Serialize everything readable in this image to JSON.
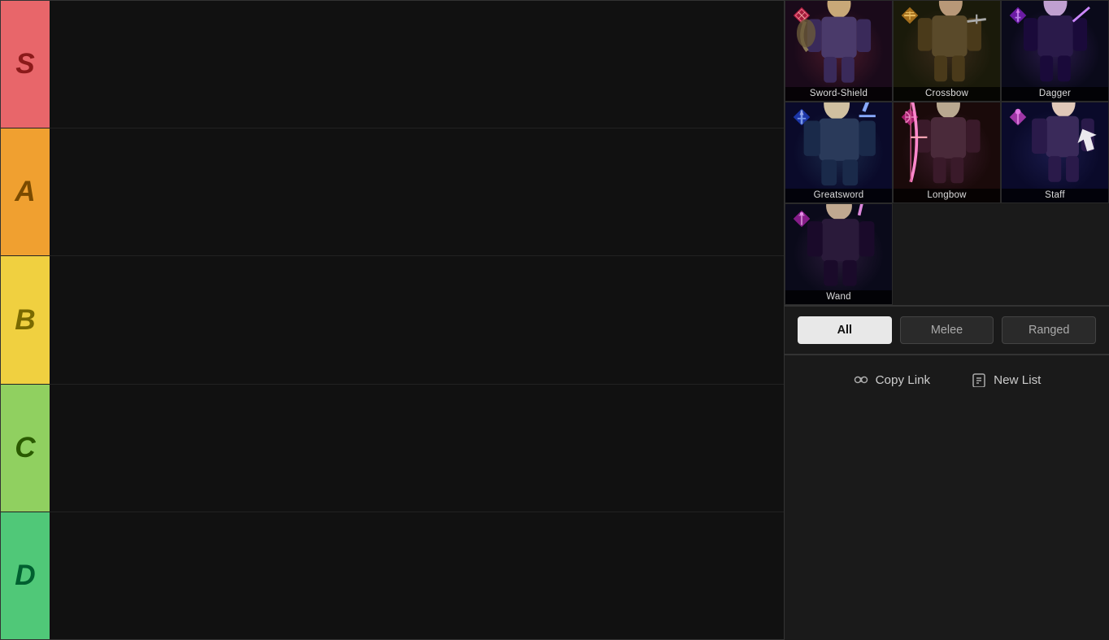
{
  "tiers": [
    {
      "id": "s",
      "label": "S",
      "color_bg": "#e8666a",
      "color_text": "#8b1a1a"
    },
    {
      "id": "a",
      "label": "A",
      "color_bg": "#f0a030",
      "color_text": "#7a4a00"
    },
    {
      "id": "b",
      "label": "B",
      "color_bg": "#f0d040",
      "color_text": "#7a6a00"
    },
    {
      "id": "c",
      "label": "C",
      "color_bg": "#90d060",
      "color_text": "#2a5a00"
    },
    {
      "id": "d",
      "label": "D",
      "color_bg": "#50c878",
      "color_text": "#006030"
    }
  ],
  "weapons": [
    {
      "id": "sword-shield",
      "name": "Sword-Shield",
      "class": "weapon-sword-shield",
      "accent": "#cc2244"
    },
    {
      "id": "crossbow",
      "name": "Crossbow",
      "class": "weapon-crossbow",
      "accent": "#cc8822"
    },
    {
      "id": "dagger",
      "name": "Dagger",
      "class": "weapon-dagger",
      "accent": "#8822cc"
    },
    {
      "id": "greatsword",
      "name": "Greatsword",
      "class": "weapon-greatsword",
      "accent": "#2244cc"
    },
    {
      "id": "longbow",
      "name": "Longbow",
      "class": "weapon-longbow",
      "accent": "#cc2288"
    },
    {
      "id": "staff",
      "name": "Staff",
      "class": "weapon-staff",
      "accent": "#cc44cc"
    },
    {
      "id": "wand",
      "name": "Wand",
      "class": "weapon-wand",
      "accent": "#aa22aa"
    }
  ],
  "filters": [
    {
      "id": "all",
      "label": "All",
      "active": true
    },
    {
      "id": "melee",
      "label": "Melee",
      "active": false
    },
    {
      "id": "ranged",
      "label": "Ranged",
      "active": false
    }
  ],
  "actions": {
    "copy_link": "Copy Link",
    "new_list": "New List"
  }
}
